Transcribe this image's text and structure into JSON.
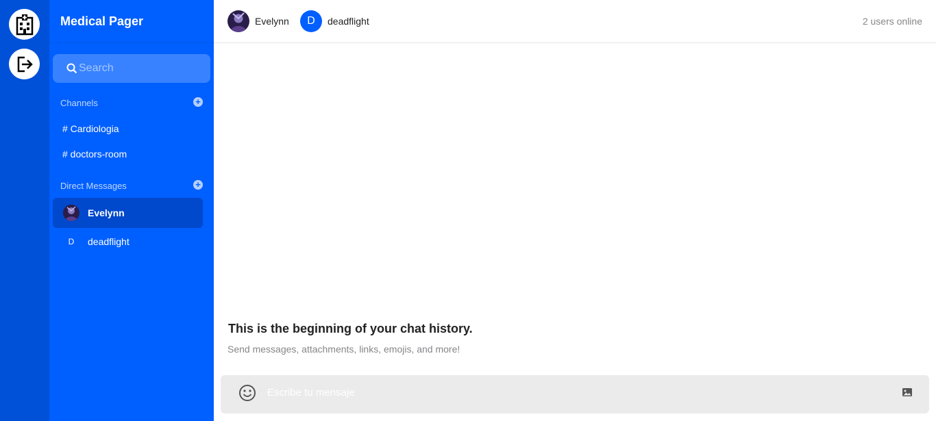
{
  "rail": {
    "buttons": [
      {
        "icon": "hospital-icon"
      },
      {
        "icon": "logout-icon"
      }
    ]
  },
  "sidebar": {
    "title": "Medical Pager",
    "search": {
      "placeholder": "Search",
      "value": ""
    },
    "channels_header": "Channels",
    "channels": [
      {
        "label": "# Cardiologia"
      },
      {
        "label": "# doctors-room"
      }
    ],
    "dms_header": "Direct Messages",
    "direct_messages": [
      {
        "name": "Evelynn",
        "avatar": "image",
        "active": true
      },
      {
        "name": "deadflight",
        "avatar_initial": "D",
        "active": false
      }
    ]
  },
  "header": {
    "members": [
      {
        "name": "Evelynn",
        "avatar": "image"
      },
      {
        "name": "deadflight",
        "avatar_initial": "D"
      }
    ],
    "online": "2 users online"
  },
  "chat": {
    "empty_title": "This is the beginning of your chat history.",
    "empty_subtitle": "Send messages, attachments, links, emojis, and more!"
  },
  "composer": {
    "placeholder": "Escribe tu mensaje",
    "value": ""
  },
  "colors": {
    "rail": "#0050d8",
    "sidebar": "#005fff",
    "active_item": "#0048cc",
    "composer_bg": "#ebebeb"
  }
}
